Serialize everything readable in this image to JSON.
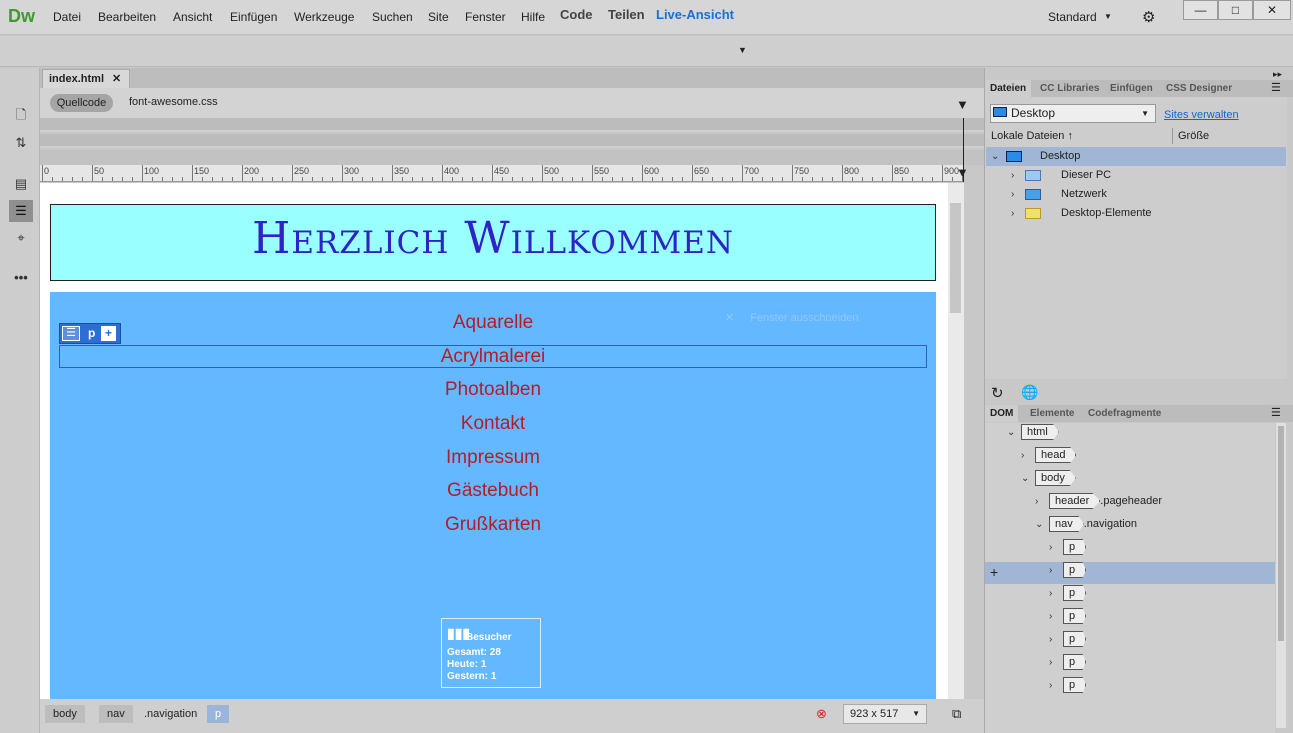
{
  "app": {
    "logo": "Dw"
  },
  "menu": [
    "Datei",
    "Bearbeiten",
    "Ansicht",
    "Einfügen",
    "Werkzeuge",
    "Suchen",
    "Site",
    "Fenster",
    "Hilfe"
  ],
  "workspace": "Standard",
  "window_buttons": [
    "—",
    "□",
    "✕"
  ],
  "view": {
    "code": "Code",
    "split": "Teilen",
    "live": "Live-Ansicht"
  },
  "doc": {
    "tab": "index.html",
    "source": "Quellcode",
    "related_file": "font-awesome.css"
  },
  "ruler": [
    0,
    50,
    100,
    150,
    200,
    250,
    300,
    350,
    400,
    450,
    500,
    550,
    600,
    650,
    700,
    750,
    800,
    850,
    900
  ],
  "page": {
    "title": "Herzlich Willkommen",
    "nav": [
      "Aquarelle",
      "Acrylmalerei",
      "Photoalben",
      "Kontakt",
      "Impressum",
      "Gästebuch",
      "Grußkarten"
    ],
    "hud_tag": "p",
    "ghost_text": "Fenster ausschneiden",
    "counter": {
      "title": "Besucher",
      "total": "Gesamt: 28",
      "today": "Heute: 1",
      "yesterday": "Gestern: 1"
    }
  },
  "status": {
    "crumbs": [
      "body",
      "nav",
      ".navigation",
      "p"
    ],
    "dims": "923 x 517"
  },
  "files_panel": {
    "tabs": [
      "Dateien",
      "CC Libraries",
      "Einfügen",
      "CSS Designer"
    ],
    "site": "Desktop",
    "manage_sites": "Sites verwalten",
    "local_files": "Lokale Dateien",
    "size": "Größe",
    "tree": [
      "Desktop",
      "Dieser PC",
      "Netzwerk",
      "Desktop-Elemente"
    ]
  },
  "dom_panel": {
    "tabs": [
      "DOM",
      "Elemente",
      "Codefragmente"
    ],
    "rows": [
      {
        "tag": "html",
        "cls": ""
      },
      {
        "tag": "head",
        "cls": ""
      },
      {
        "tag": "body",
        "cls": ""
      },
      {
        "tag": "header",
        "cls": ".pageheader"
      },
      {
        "tag": "nav",
        "cls": ".navigation"
      },
      {
        "tag": "p",
        "cls": ""
      },
      {
        "tag": "p",
        "cls": ""
      },
      {
        "tag": "p",
        "cls": ""
      },
      {
        "tag": "p",
        "cls": ""
      },
      {
        "tag": "p",
        "cls": ""
      },
      {
        "tag": "p",
        "cls": ""
      },
      {
        "tag": "p",
        "cls": ""
      }
    ]
  }
}
